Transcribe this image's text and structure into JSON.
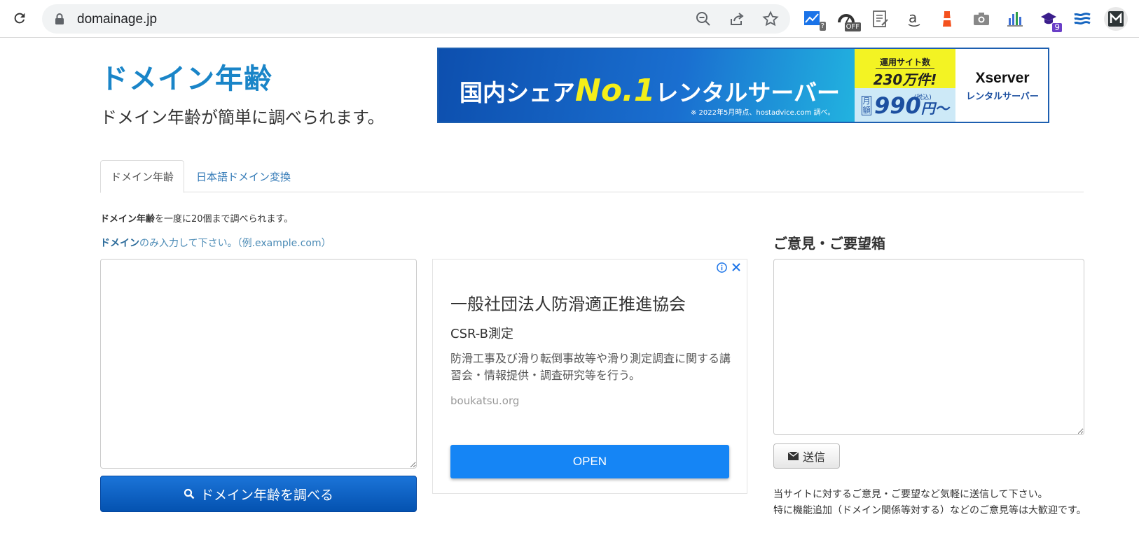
{
  "browser": {
    "url": "domainage.jp",
    "extensions": [
      {
        "name": "chart-extension-icon",
        "badge": "?",
        "badge_color": "#6b6b6b"
      },
      {
        "name": "speedometer-extension-icon",
        "badge": "OFF",
        "badge_color": "#555555"
      },
      {
        "name": "notes-extension-icon",
        "badge": ""
      },
      {
        "name": "amazon-extension-icon",
        "badge": ""
      },
      {
        "name": "lighthouse-extension-icon",
        "badge": ""
      },
      {
        "name": "camera-extension-icon",
        "badge": ""
      },
      {
        "name": "bars-extension-icon",
        "badge": ""
      },
      {
        "name": "cap-extension-icon",
        "badge": "9",
        "badge_color": "#6a3fc7"
      },
      {
        "name": "waves-extension-icon",
        "badge": ""
      },
      {
        "name": "m-extension-icon",
        "badge": ""
      }
    ]
  },
  "site": {
    "title": "ドメイン年齢",
    "subtitle": "ドメイン年齢が簡単に調べられます。"
  },
  "banner": {
    "main_prefix": "国内シェア",
    "main_no1": "No.1",
    "main_suffix": "レンタルサーバー",
    "note": "※ 2022年5月時点、hostadvice.com 調べ。",
    "yellow_line1": "運用サイト数",
    "yellow_line2": "230万件!",
    "price_label": "月額",
    "price": "990",
    "price_unit": "円〜",
    "price_tax": "(税込)",
    "logo_line1": "Xserver",
    "logo_line2": "レンタルサーバー"
  },
  "tabs": [
    {
      "label": "ドメイン年齢",
      "active": true
    },
    {
      "label": "日本語ドメイン変換",
      "active": false
    }
  ],
  "form": {
    "desc_bold": "ドメイン年齢",
    "desc_rest": "を一度に20個まで調べられます。",
    "hint_bold": "ドメイン",
    "hint_rest": "のみ入力して下さい。（例.example.com）",
    "textarea_value": "",
    "search_button": "ドメイン年齢を調べる"
  },
  "ad": {
    "title": "一般社団法人防滑適正推進協会",
    "subtitle": "CSR-B測定",
    "body": "防滑工事及び滑り転倒事故等や滑り測定調査に関する講習会・情報提供・調査研究等を行う。",
    "url": "boukatsu.org",
    "button": "OPEN"
  },
  "feedback": {
    "title": "ご意見・ご要望箱",
    "textarea_value": "",
    "send_button": "送信",
    "note1": "当サイトに対するご意見・ご要望など気軽に送信して下さい。",
    "note2": "特に機能追加（ドメイン関係等対する）などのご意見等は大歓迎です。"
  },
  "colors": {
    "accent": "#1a85c8",
    "link": "#337ab7",
    "search_button": "#0452b0",
    "ad_button": "#1585f5"
  }
}
